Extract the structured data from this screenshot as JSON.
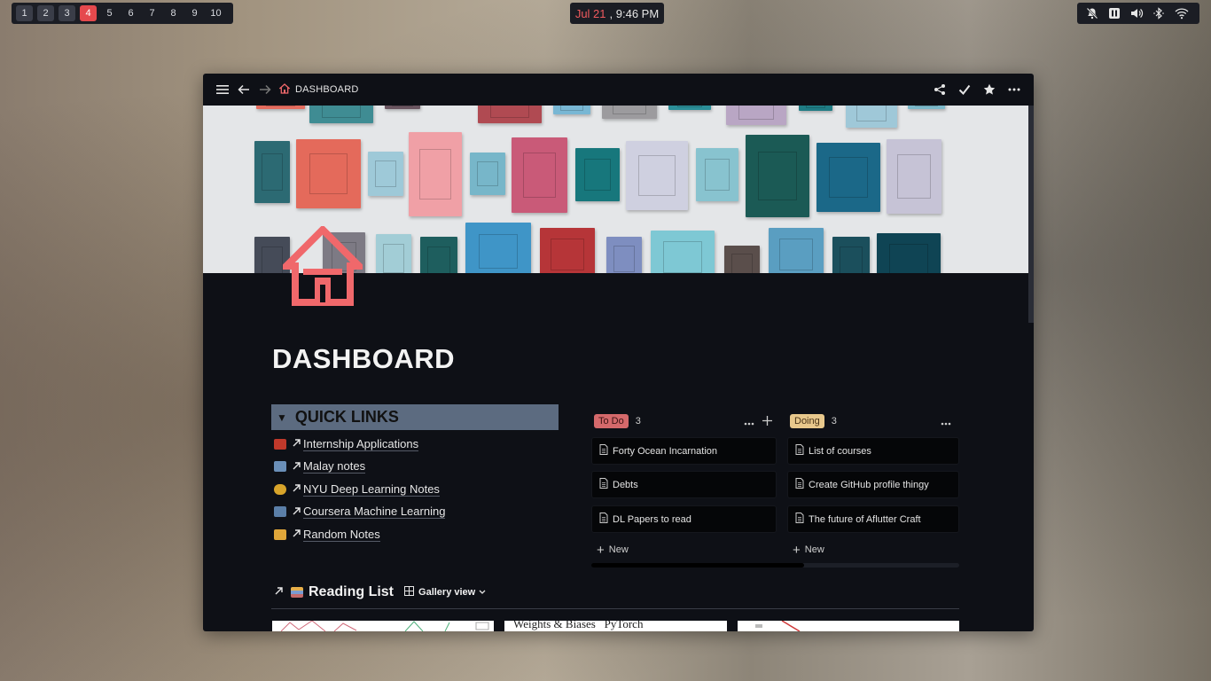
{
  "topbar": {
    "workspaces": [
      "1",
      "2",
      "3",
      "4",
      "5",
      "6",
      "7",
      "8",
      "9",
      "10"
    ],
    "occupied": [
      "1",
      "2",
      "3"
    ],
    "active_workspace": "4",
    "clock": {
      "date": "Jul 21",
      "time": ", 9:46 PM"
    },
    "tray_icons": [
      "notifications-off-icon",
      "pause-icon",
      "volume-icon",
      "bluetooth-icon",
      "wifi-icon"
    ]
  },
  "window": {
    "breadcrumb": "DASHBOARD",
    "toolbar_icons": [
      "share-icon",
      "check-icon",
      "star-icon",
      "more-icon"
    ]
  },
  "page": {
    "title": "DASHBOARD",
    "icon": "house-icon",
    "accent": "#f0686b"
  },
  "quick_links": {
    "heading": "QUICK LINKS",
    "items": [
      {
        "label": "Internship Applications",
        "emoji_color": "#c0392b"
      },
      {
        "label": "Malay notes",
        "emoji_color": "#6a8fb8"
      },
      {
        "label": "NYU Deep Learning Notes",
        "emoji_color": "#d8a42a"
      },
      {
        "label": "Coursera Machine Learning",
        "emoji_color": "#5b7fa8"
      },
      {
        "label": "Random Notes",
        "emoji_color": "#e0a63a"
      }
    ]
  },
  "board": {
    "columns": [
      {
        "name": "To Do",
        "count": "3",
        "cards": [
          "Forty Ocean Incarnation",
          "Debts",
          "DL Papers to read"
        ],
        "new_label": "New"
      },
      {
        "name": "Doing",
        "count": "3",
        "cards": [
          "List of courses",
          "Create GitHub profile thingy",
          "The future of Aflutter Craft"
        ],
        "new_label": "New"
      }
    ]
  },
  "reading_list": {
    "title": "Reading List",
    "view": "Gallery view",
    "cards": [
      "",
      "Weights & Biases   PyTorch",
      ""
    ]
  }
}
